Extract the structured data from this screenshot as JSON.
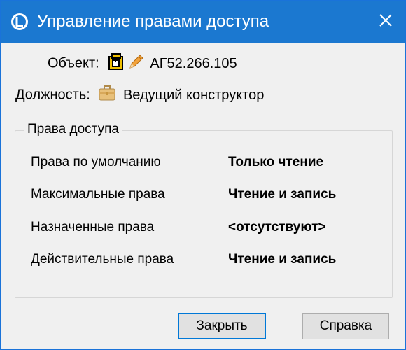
{
  "window": {
    "title": "Управление правами доступа",
    "icons": {
      "app": "app-logo-icon",
      "close": "close-icon"
    }
  },
  "object": {
    "label": "Объект:",
    "value": "АГ52.266.105",
    "icons": [
      "document-package-icon",
      "pencil-icon"
    ]
  },
  "position": {
    "label": "Должность:",
    "value": "Ведущий конструктор",
    "icon": "briefcase-icon"
  },
  "access_rights": {
    "legend": "Права доступа",
    "rows": [
      {
        "label": "Права по умолчанию",
        "value": "Только чтение"
      },
      {
        "label": "Максимальные права",
        "value": "Чтение и запись"
      },
      {
        "label": "Назначенные права",
        "value": "<отсутствуют>"
      },
      {
        "label": "Действительные права",
        "value": "Чтение и запись"
      }
    ]
  },
  "buttons": {
    "close_label": "Закрыть",
    "help_label": "Справка"
  },
  "colors": {
    "titlebar": "#1b78d0",
    "background": "#f0f0f0",
    "default_button_border": "#0078d7"
  }
}
